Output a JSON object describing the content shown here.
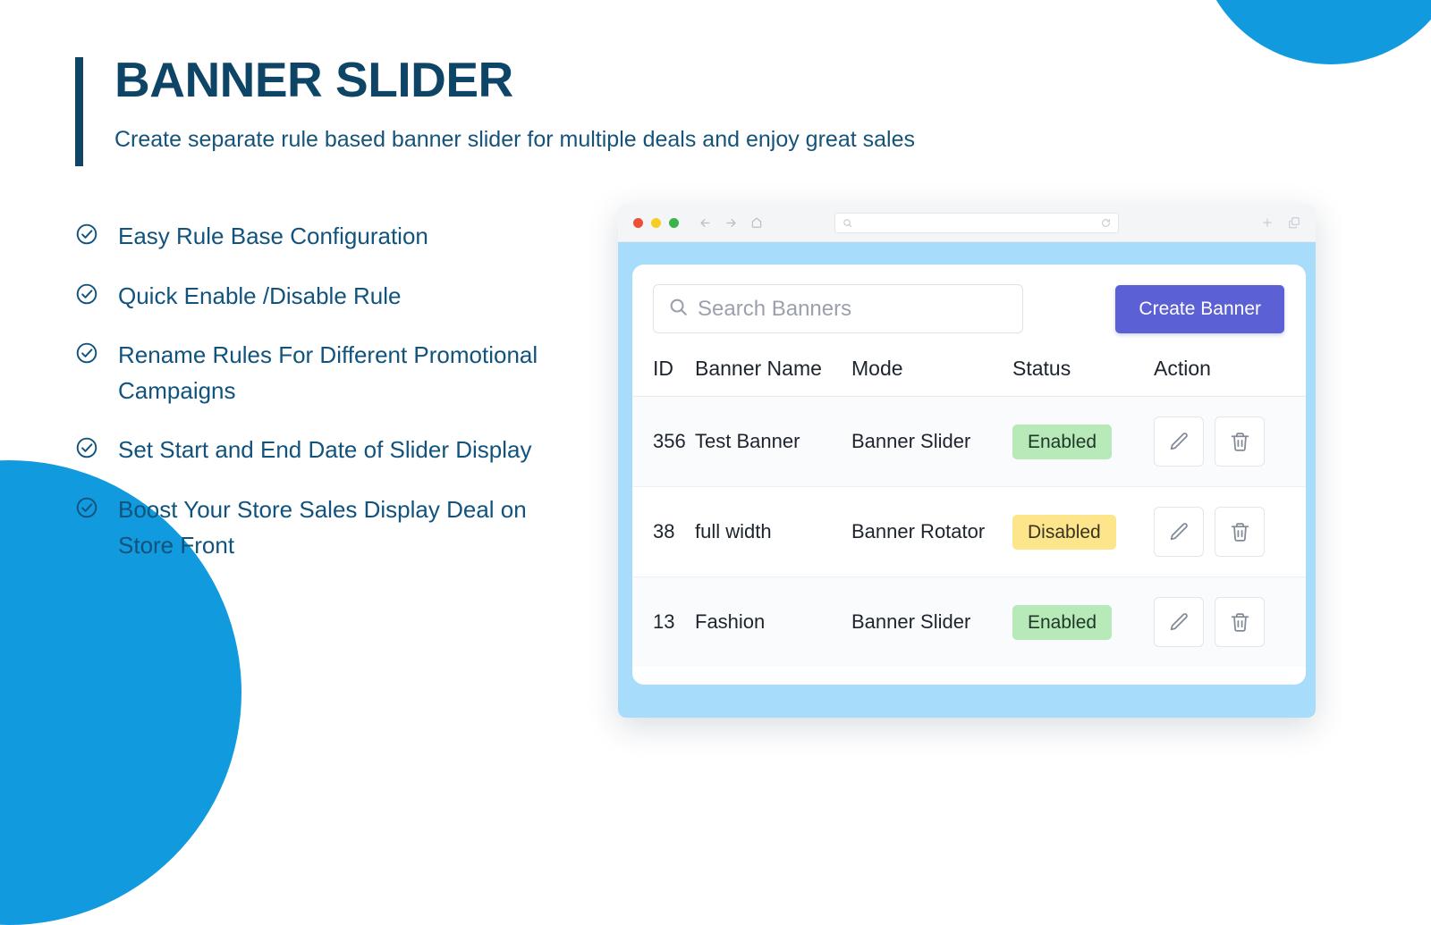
{
  "theme": {
    "navy": "#0e4566",
    "body_blue": "#11537c",
    "accent_blue": "#119ade",
    "panel_blue": "#a7ddfa",
    "button_indigo": "#5b60d4",
    "id_orange": "#ef5b3b",
    "enabled_green": "#b7eab8",
    "disabled_yellow": "#fce58a"
  },
  "hero": {
    "title": "BANNER SLIDER",
    "subtitle": "Create separate rule based banner slider for multiple deals and enjoy great sales"
  },
  "features": [
    {
      "icon": "circle-check-icon",
      "label": "Easy Rule Base Configuration"
    },
    {
      "icon": "circle-check-icon",
      "label": "Quick Enable /Disable Rule"
    },
    {
      "icon": "circle-check-icon",
      "label": "Rename Rules For Different Promotional Campaigns"
    },
    {
      "icon": "circle-check-icon",
      "label": "Set Start and End Date of Slider Display"
    },
    {
      "icon": "circle-check-icon",
      "label": "Boost Your Store Sales Display Deal on Store Front"
    }
  ],
  "browser": {
    "traffic_lights": [
      "close-red",
      "minimize-yellow",
      "maximize-green"
    ],
    "nav_icons": [
      "back-arrow-icon",
      "forward-arrow-icon",
      "home-icon"
    ],
    "url_value": "",
    "url_placeholder": "",
    "url_icons": [
      "search-icon",
      "reload-icon"
    ],
    "right_icons": [
      "plus-icon",
      "tabs-icon"
    ]
  },
  "app": {
    "search": {
      "icon": "search-icon",
      "value": "",
      "placeholder": "Search Banners"
    },
    "create_button": {
      "label": "Create Banner",
      "icon": null
    },
    "table": {
      "columns": [
        "ID",
        "Banner Name",
        "Mode",
        "Status",
        "Action"
      ],
      "rows": [
        {
          "id": "356",
          "name": "Test Banner",
          "mode": "Banner Slider",
          "status": "Enabled",
          "status_kind": "enabled",
          "actions": [
            "edit-icon",
            "delete-icon"
          ]
        },
        {
          "id": "38",
          "name": "full width",
          "mode": "Banner Rotator",
          "status": "Disabled",
          "status_kind": "disabled",
          "actions": [
            "edit-icon",
            "delete-icon"
          ]
        },
        {
          "id": "13",
          "name": "Fashion",
          "mode": "Banner Slider",
          "status": "Enabled",
          "status_kind": "enabled",
          "actions": [
            "edit-icon",
            "delete-icon"
          ]
        }
      ]
    }
  }
}
